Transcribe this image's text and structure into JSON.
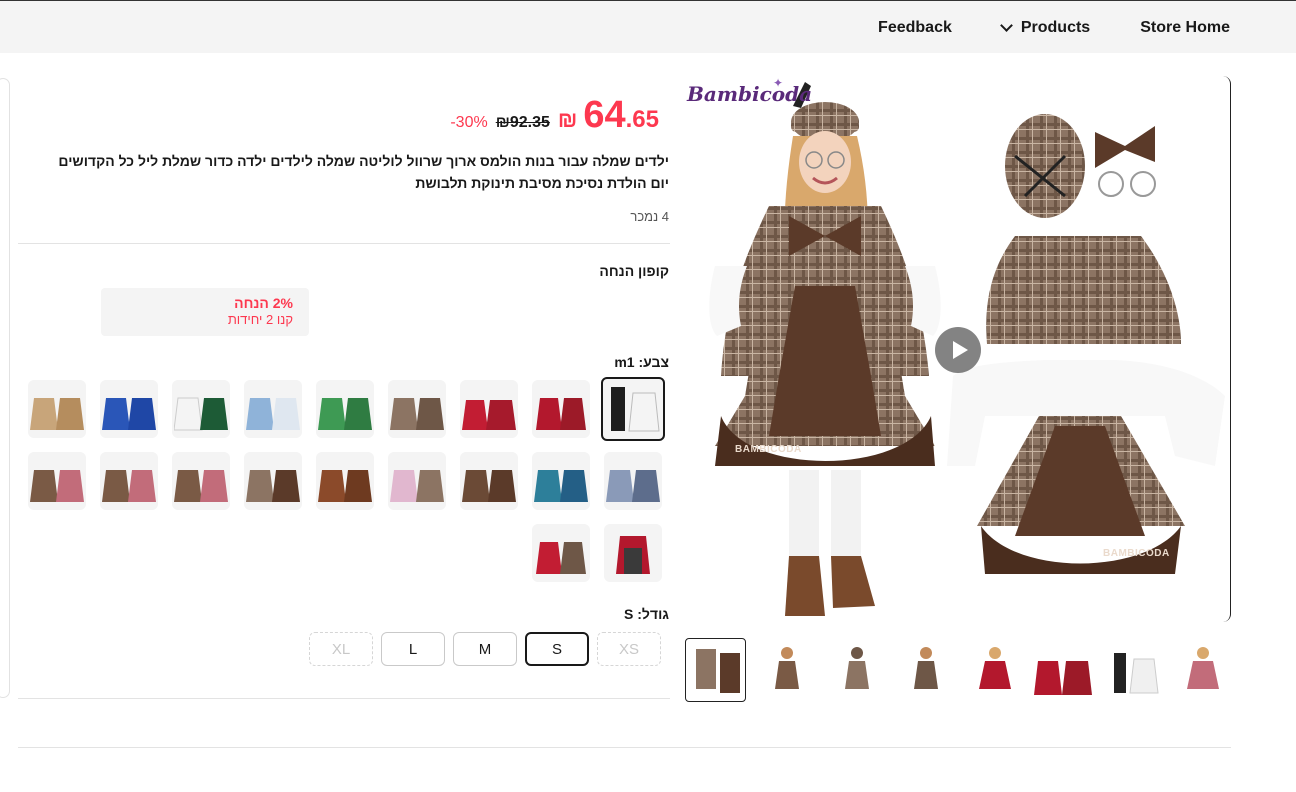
{
  "nav": {
    "feedback": "Feedback",
    "products": "Products",
    "store_home": "Store Home"
  },
  "product": {
    "brand": "Bambicoda",
    "watermark": "BAMBICODA",
    "price_currency": "₪",
    "price_int": "64",
    "price_dec": ".65",
    "price_old": "₪92.35",
    "discount": "-30%",
    "title": "ילדים שמלה עבור בנות הולמס ארוך שרוול לוליטה שמלה לילדים ילדה כדור שמלת ליל כל הקדושים יום הולדת נסיכת מסיבת תינוקת תלבושת",
    "sold": "4 נמכר"
  },
  "coupon": {
    "title": "קופון הנחה",
    "percent": "2% הנחה",
    "condition": "קנו 2 יחידות"
  },
  "color": {
    "title": "צבע: m1",
    "selected_index": 0,
    "count": 20
  },
  "size": {
    "title": "גודל: S",
    "options": [
      "XS",
      "S",
      "M",
      "L",
      "XL"
    ],
    "selected": "S",
    "disabled": [
      "XS",
      "XL"
    ]
  },
  "colors": {
    "accent": "#fd384f",
    "text": "#191919",
    "plaid": "#8c7463",
    "brown": "#5b3a29"
  }
}
